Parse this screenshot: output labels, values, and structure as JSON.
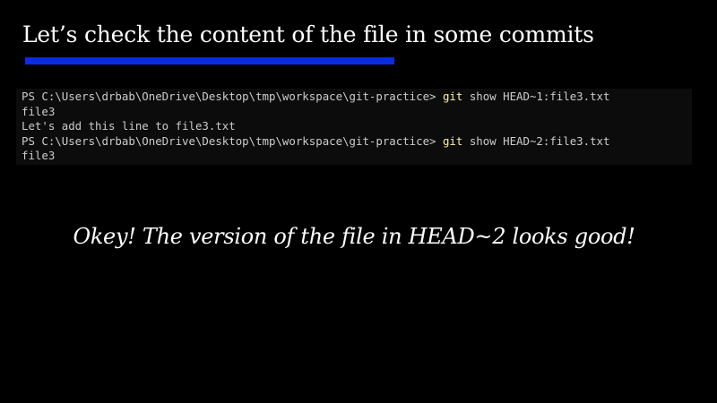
{
  "slide": {
    "title": "Let’s check the content of the file in some commits",
    "accent_color": "#0b2be0",
    "caption": "Okey! The version of the file in HEAD~2 looks good!"
  },
  "terminal": {
    "lines": [
      {
        "prompt": "PS C:\\Users\\drbab\\OneDrive\\Desktop\\tmp\\workspace\\git-practice> ",
        "git": "git",
        "args": " show HEAD~1:file3.txt"
      },
      {
        "output": "file3"
      },
      {
        "output": "Let's add this line to file3.txt"
      },
      {
        "prompt": "PS C:\\Users\\drbab\\OneDrive\\Desktop\\tmp\\workspace\\git-practice> ",
        "git": "git",
        "args": " show HEAD~2:file3.txt"
      },
      {
        "output": "file3"
      }
    ]
  }
}
